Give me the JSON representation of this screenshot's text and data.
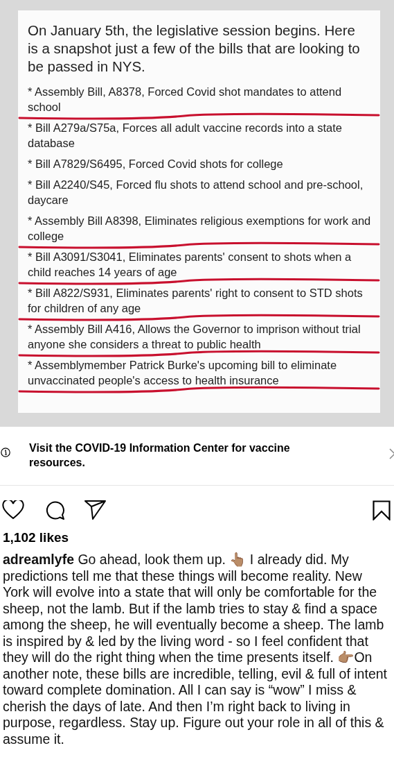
{
  "post_image": {
    "heading": "On January 5th, the legislative session begins. Here is a snapshot just a few of the bills that are looking to be passed in NYS.",
    "bills": [
      {
        "text": "* Assembly Bill, A8378, Forced Covid shot mandates to attend school",
        "underlined": true
      },
      {
        "text": "* Bill A279a/S75a, Forces all adult vaccine records into a state database",
        "underlined": false
      },
      {
        "text": "* Bill A7829/S6495, Forced Covid shots for college",
        "underlined": false
      },
      {
        "text": "* Bill A2240/S45, Forced flu shots to attend school and pre-school, daycare",
        "underlined": false
      },
      {
        "text": "* Assembly Bill A8398, Eliminates religious exemptions for work and college",
        "underlined": true
      },
      {
        "text": "* Bill A3091/S3041, Eliminates parents' consent to shots when a child reaches 14 years of age",
        "underlined": true
      },
      {
        "text": "* Bill A822/S931, Eliminates parents' right to consent to STD shots for children of any age",
        "underlined": true
      },
      {
        "text": "* Assembly Bill A416, Allows the Governor to imprison without trial anyone she considers a threat to public health",
        "underlined": true
      },
      {
        "text": "* Assemblymember Patrick Burke's upcoming bill to eliminate unvaccinated people's access to health insurance",
        "underlined": true
      }
    ]
  },
  "info_banner": {
    "text": "Visit the COVID-19 Information Center for vaccine resources."
  },
  "likes": "1,102 likes",
  "caption": "**adreamlyfe** Go ahead, look them up. 👆🏽 I already did. My predictions tell me that these things will become reality. New York will evolve into a state that will only be comfortable for the sheep, not the lamb. But if the lamb tries to stay & find a space among the sheep, he will eventually become a sheep. The lamb is inspired by & led by the living word - so I feel confident that they will do the right thing when the time presents itself. 👉🏽On another note, these bills are incredible, telling, evil & full of intent toward complete domination. All I can say is “wow” I miss & cherish the days of late. And then I’m right back to living in purpose, regardless. Stay up. Figure out your role in all of this & assume it."
}
